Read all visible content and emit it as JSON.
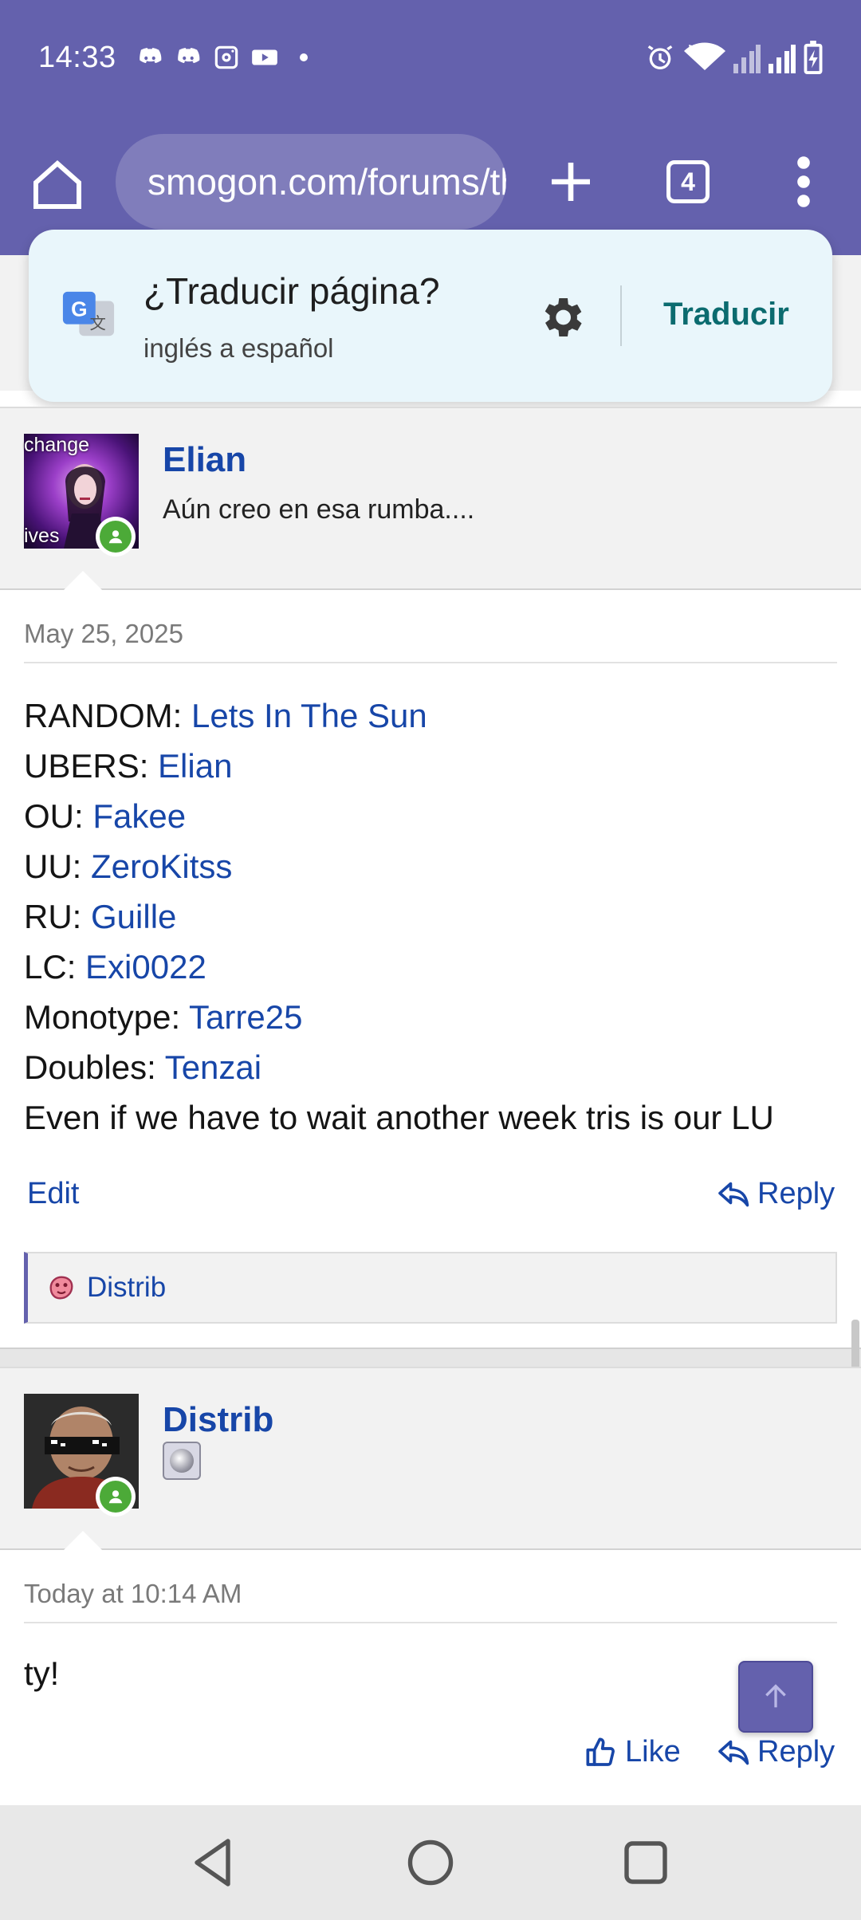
{
  "status_bar": {
    "time": "14:33",
    "notification_icons": [
      "discord-icon",
      "discord-icon",
      "instagram-icon",
      "youtube-icon"
    ],
    "right_icons": [
      "alarm-icon",
      "wifi-icon",
      "signal-icon",
      "signal-icon",
      "battery-charging-icon"
    ]
  },
  "browser": {
    "url": "smogon.com/forums/threads",
    "tab_count": "4"
  },
  "translate_popup": {
    "title": "¿Traducir página?",
    "subtitle": "inglés a español",
    "action": "Traducir"
  },
  "posts": [
    {
      "author": "Elian",
      "user_title": "Aún creo en esa rumba....",
      "avatar_caption_top": "change",
      "avatar_caption_bottom": "ives",
      "date": "May 25, 2025",
      "lines": [
        {
          "label": "RANDOM: ",
          "value": "Lets In The Sun"
        },
        {
          "label": "UBERS: ",
          "value": "Elian"
        },
        {
          "label": "OU: ",
          "value": "Fakee"
        },
        {
          "label": "UU: ",
          "value": "ZeroKitss"
        },
        {
          "label": "RU: ",
          "value": "Guille"
        },
        {
          "label": "LC: ",
          "value": "Exi0022"
        },
        {
          "label": "Monotype: ",
          "value": "Tarre25"
        },
        {
          "label": "Doubles: ",
          "value": "Tenzai"
        }
      ],
      "closing_line": "Even if we have to wait another week tris is our LU",
      "edit_label": "Edit",
      "reply_label": "Reply",
      "liked_by": "Distrib"
    },
    {
      "author": "Distrib",
      "date": "Today at 10:14 AM",
      "text": "ty!",
      "like_label": "Like",
      "reply_label": "Reply"
    }
  ],
  "colors": {
    "chrome": "#6461ad",
    "link": "#1746a8",
    "translate_action": "#0b6b6f",
    "online": "#4caa38"
  }
}
